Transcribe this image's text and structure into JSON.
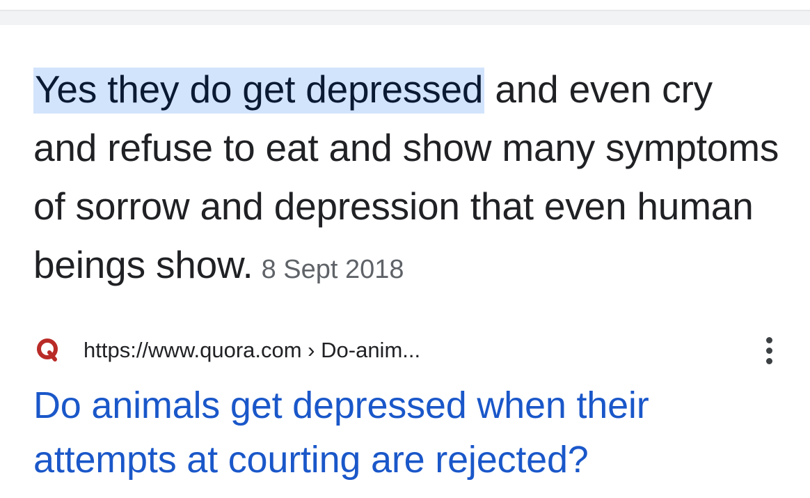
{
  "snippet": {
    "highlight": "Yes they do get depressed",
    "rest": " and even cry and refuse to eat and show many symptoms of sorrow and depression that even human beings show.",
    "date": "8 Sept 2018"
  },
  "source": {
    "favicon_icon": "quora-q-icon",
    "url": "https://www.quora.com › Do-anim...",
    "more_icon": "more-vert-icon"
  },
  "result": {
    "title": "Do animals get depressed when their attempts at courting are rejected?"
  },
  "colors": {
    "highlight_bg": "#d2e3fc",
    "link": "#1a57c9",
    "quora_red": "#b92b27",
    "date_gray": "#5f6368"
  }
}
